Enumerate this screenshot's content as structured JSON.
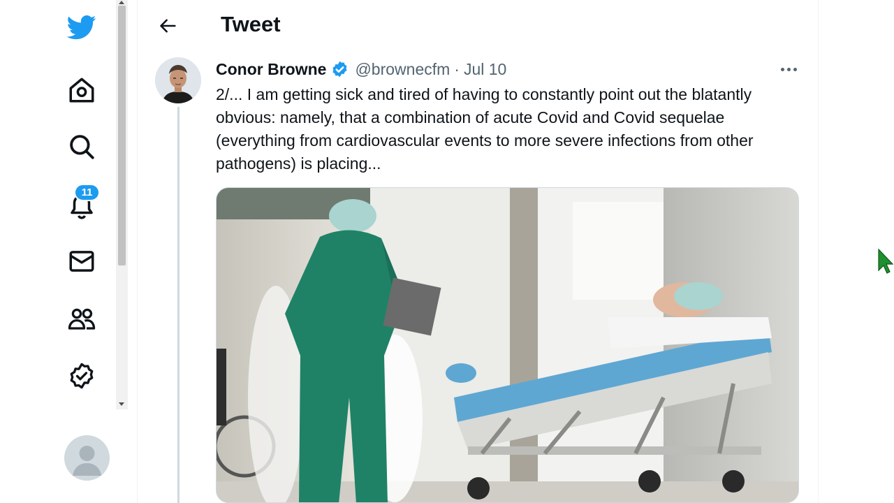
{
  "nav": {
    "items": [
      {
        "name": "home",
        "icon": "home-icon"
      },
      {
        "name": "explore",
        "icon": "search-icon"
      },
      {
        "name": "notifications",
        "icon": "bell-icon"
      },
      {
        "name": "messages",
        "icon": "envelope-icon"
      },
      {
        "name": "communities",
        "icon": "people-icon"
      },
      {
        "name": "verified",
        "icon": "verified-badge-icon"
      }
    ],
    "notification_count": "11"
  },
  "header": {
    "title": "Tweet"
  },
  "tweet": {
    "author_name": "Conor Browne",
    "handle": "@brownecfm",
    "separator": "·",
    "date": "Jul 10",
    "text": "2/... I am getting sick and tired of having to constantly point out the blatantly obvious: namely, that a combination of acute Covid and Covid sequelae (everything from cardiovascular events to more severe infections from other pathogens) is placing..."
  },
  "colors": {
    "brand": "#1d9bf0",
    "text_primary": "#0f1419",
    "text_secondary": "#536471",
    "cursor": "#1f8f2f"
  }
}
